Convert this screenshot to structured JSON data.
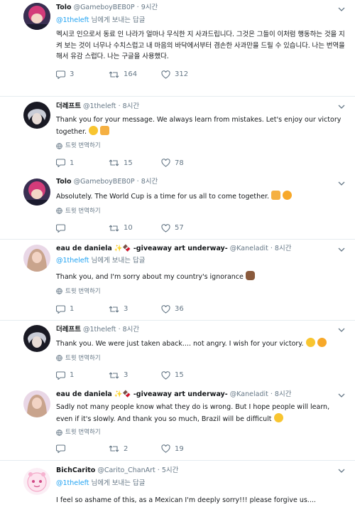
{
  "tweets": [
    {
      "name": "Tolo",
      "handle": "@GameboyBEB0P",
      "time": "· 9시간",
      "reply_mention": "@1theleft",
      "reply_suffix": " 님에게 보내는 답글",
      "body": "멕시코 인으로서 동료 인 나라가 얼마나 무식한 지 사과드립니다. 그것은 그들이 이처럼 행동하는 것을 지켜 보는 것이 너무나 수치스럽고 내 마음의 바닥에서부터 겸손한 사과만을 드릴 수 있습니다. 나는 번역을해서 유감 스럽다. 나는 구글을 사용했다.",
      "reply_count": "3",
      "retweet_count": "164",
      "like_count": "312"
    },
    {
      "name": "더레프트",
      "handle": "@1theleft",
      "time": "· 8시간",
      "body": "Thank you for your message. We always learn from mistakes. Let's enjoy our victory together.",
      "translate": "트윗 번역하기",
      "reply_count": "1",
      "retweet_count": "15",
      "like_count": "78"
    },
    {
      "name": "Tolo",
      "handle": "@GameboyBEB0P",
      "time": "· 8시간",
      "body": "Absolutely. The World Cup is a time for us all to come together.",
      "translate": "트윗 번역하기",
      "reply_count": "",
      "retweet_count": "10",
      "like_count": "57"
    },
    {
      "name": "eau de daniela",
      "name_deco": "✨🍫 -giveaway art underway-",
      "handle": "@Kaneladit",
      "time": "· 8시간",
      "reply_mention": "@1theleft",
      "reply_suffix": " 님에게 보내는 답글",
      "body": "Thank you, and I'm sorry about my country's ignorance",
      "translate": "트윗 번역하기",
      "reply_count": "1",
      "retweet_count": "3",
      "like_count": "36"
    },
    {
      "name": "더레프트",
      "handle": "@1theleft",
      "time": "· 8시간",
      "body": "Thank you. We were just taken aback.... not angry. I wish for your victory.",
      "translate": "트윗 번역하기",
      "reply_count": "1",
      "retweet_count": "3",
      "like_count": "15"
    },
    {
      "name": "eau de daniela",
      "name_deco": "✨🍫 -giveaway art underway-",
      "handle": "@Kaneladit",
      "time": "· 8시간",
      "body": "Sadly not many people know what they do is wrong. But I hope people will learn, even if it's slowly. And thank you so much, Brazil will be difficult",
      "translate": "트윗 번역하기",
      "reply_count": "",
      "retweet_count": "2",
      "like_count": "19"
    },
    {
      "name": "BichCarito",
      "handle": "@Carito_ChanArt",
      "time": "· 5시간",
      "reply_mention": "@1theleft",
      "reply_suffix": " 님에게 보내는 답글",
      "body": "I feel so ashame of this, as a Mexican I'm deeply sorry!!!  please forgive us...."
    }
  ],
  "colors": {
    "accent": "#1da1f2",
    "muted": "#657786",
    "divider": "#e6ecf0"
  },
  "icons": [
    "reply-icon",
    "retweet-icon",
    "like-icon",
    "globe-icon",
    "chevron-down-icon"
  ]
}
